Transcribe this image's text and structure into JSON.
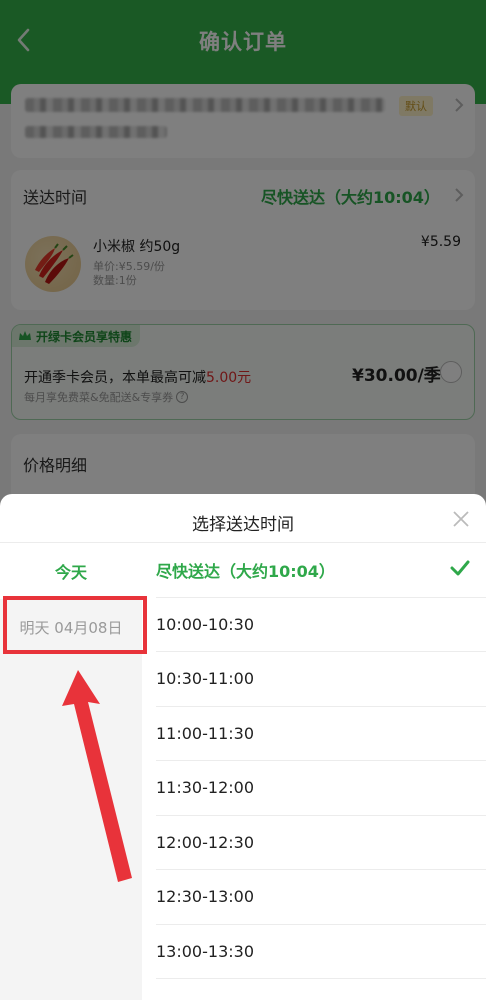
{
  "header": {
    "title": "确认订单"
  },
  "address": {
    "default_tag": "默认"
  },
  "delivery": {
    "label": "送达时间",
    "value": "尽快送达（大约10:04）"
  },
  "product": {
    "name": "小米椒 约50g",
    "unit_price": "单价:¥5.59/份",
    "quantity": "数量:1份",
    "price": "¥5.59"
  },
  "membership": {
    "tag": "开绿卡会员享特惠",
    "line_prefix": "开通季卡会员，本单最高可减",
    "line_amount": "5.00元",
    "subline": "每月享免费菜&免配送&专享券",
    "price": "¥30.00/季"
  },
  "price_detail": {
    "label": "价格明细"
  },
  "sheet": {
    "title": "选择送达时间",
    "days": [
      {
        "label": "今天",
        "selected": true
      },
      {
        "label": "明天 04月08日",
        "selected": false
      }
    ],
    "slots": [
      {
        "label": "尽快送达（大约10:04）",
        "selected": true
      },
      {
        "label": "10:00-10:30"
      },
      {
        "label": "10:30-11:00"
      },
      {
        "label": "11:00-11:30"
      },
      {
        "label": "11:30-12:00"
      },
      {
        "label": "12:00-12:30"
      },
      {
        "label": "12:30-13:00"
      },
      {
        "label": "13:00-13:30"
      }
    ]
  },
  "colors": {
    "brand_green": "#35b34a",
    "accent_green": "#2fa84a",
    "annotation_red": "#e8333a"
  }
}
